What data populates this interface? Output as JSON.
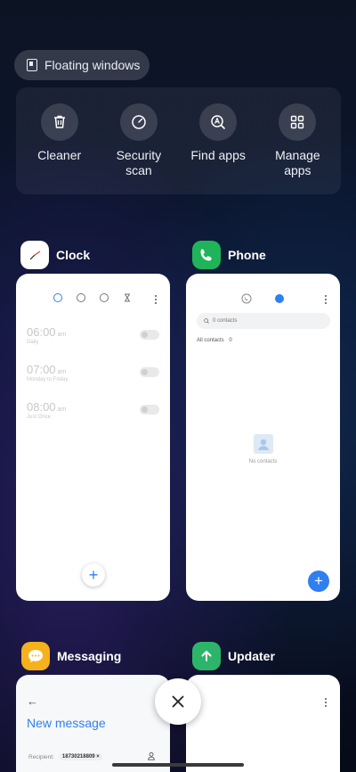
{
  "floating": {
    "label": "Floating windows"
  },
  "tools": [
    {
      "label": "Cleaner",
      "icon": "trash-icon"
    },
    {
      "label": "Security\nscan",
      "icon": "security-scan-icon"
    },
    {
      "label": "Find apps",
      "icon": "find-apps-icon"
    },
    {
      "label": "Manage\napps",
      "icon": "grid-icon"
    }
  ],
  "apps": {
    "clock": {
      "name": "Clock",
      "alarms": [
        {
          "time": "06:00",
          "ampm": "am",
          "repeat": "Daily"
        },
        {
          "time": "07:00",
          "ampm": "am",
          "repeat": "Monday to Friday"
        },
        {
          "time": "08:00",
          "ampm": "am",
          "repeat": "Just Once"
        }
      ]
    },
    "phone": {
      "name": "Phone",
      "search_placeholder": "0 contacts",
      "all_contacts": "All contacts",
      "all_contacts_count": "0",
      "empty_text": "No contacts"
    },
    "messaging": {
      "name": "Messaging",
      "title": "New message",
      "recipient_label": "Recipient:",
      "recipient_value": "18730218809"
    },
    "updater": {
      "name": "Updater"
    }
  },
  "colors": {
    "accent_blue": "#2f7ff0",
    "phone_green": "#1fb45a",
    "messaging_orange": "#f6b21c",
    "updater_green": "#2cb56a"
  }
}
